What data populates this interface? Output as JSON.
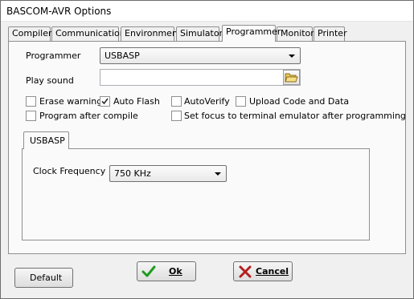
{
  "window": {
    "title": "BASCOM-AVR Options"
  },
  "tabs": [
    {
      "label": "Compiler"
    },
    {
      "label": "Communication"
    },
    {
      "label": "Environment"
    },
    {
      "label": "Simulator"
    },
    {
      "label": "Programmer",
      "active": true
    },
    {
      "label": "Monitor"
    },
    {
      "label": "Printer"
    }
  ],
  "programmer": {
    "programmer_label": "Programmer",
    "programmer_value": "USBASP",
    "play_sound_label": "Play sound",
    "play_sound_value": "",
    "checkboxes": {
      "erase_warning": {
        "label": "Erase warning",
        "checked": false
      },
      "auto_flash": {
        "label": "Auto Flash",
        "checked": true
      },
      "auto_verify": {
        "label": "AutoVerify",
        "checked": false
      },
      "upload_code_and_data": {
        "label": "Upload Code and Data",
        "checked": false
      },
      "program_after_compile": {
        "label": "Program after compile",
        "checked": false
      },
      "set_focus_terminal": {
        "label": "Set focus to terminal emulator after programming",
        "checked": false
      }
    },
    "inner_tab": {
      "label": "USBASP"
    },
    "clock_label": "Clock Frequency",
    "clock_value": "750 KHz"
  },
  "buttons": {
    "default_label": "Default",
    "ok_label": "Ok",
    "cancel_label": "Cancel"
  },
  "colors": {
    "ok_icon": "#1e9b1e",
    "cancel_icon": "#b31f1f"
  }
}
